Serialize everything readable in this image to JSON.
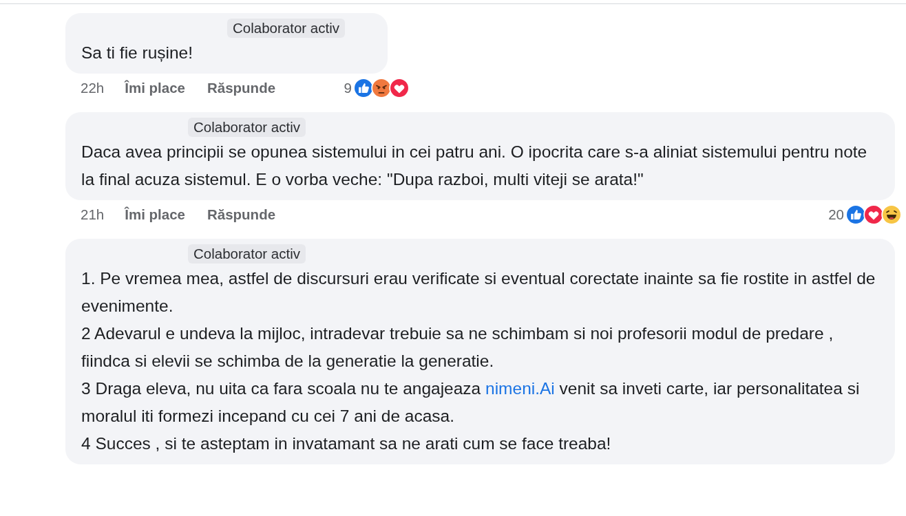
{
  "comments": [
    {
      "badge": "Colaborator activ",
      "paragraphs": [
        [
          {
            "kind": "text",
            "text": "Sa ti fie rușine!"
          }
        ]
      ],
      "time": "22h",
      "like": "Îmi place",
      "reply": "Răspunde",
      "reaction_count": "9",
      "reactions": [
        {
          "kind": "like"
        },
        {
          "kind": "angry"
        },
        {
          "kind": "love"
        }
      ],
      "wide": false
    },
    {
      "badge": "Colaborator activ",
      "paragraphs": [
        [
          {
            "kind": "text",
            "text": "Daca avea principii se opunea sistemului in cei patru ani. O ipocrita care s-a aliniat sistemului pentru note la final acuza sistemul. E o vorba veche: \"Dupa razboi, multi viteji se arata!\""
          }
        ]
      ],
      "time": "21h",
      "like": "Îmi place",
      "reply": "Răspunde",
      "reaction_count": "20",
      "reactions": [
        {
          "kind": "like"
        },
        {
          "kind": "love"
        },
        {
          "kind": "haha"
        }
      ],
      "wide": true
    },
    {
      "badge": "Colaborator activ",
      "paragraphs": [
        [
          {
            "kind": "text",
            "text": "1. Pe vremea mea, astfel de discursuri erau verificate si eventual corectate inainte sa fie rostite in astfel de evenimente."
          }
        ],
        [
          {
            "kind": "text",
            "text": "2 Adevarul e undeva la mijloc, intradevar trebuie sa ne schimbam si noi profesorii modul de predare , fiindca si elevii se schimba de la generatie la generatie."
          }
        ],
        [
          {
            "kind": "text",
            "text": "3 Draga eleva, nu uita ca fara scoala nu te angajeaza "
          },
          {
            "kind": "link",
            "text": "nimeni.Ai"
          },
          {
            "kind": "text",
            "text": " venit sa inveti carte, iar personalitatea si moralul iti formezi incepand cu cei 7 ani de acasa."
          }
        ],
        [
          {
            "kind": "text",
            "text": "4 Succes , si te asteptam in invatamant sa ne arati cum se face treaba!"
          }
        ]
      ],
      "wide": true
    }
  ]
}
